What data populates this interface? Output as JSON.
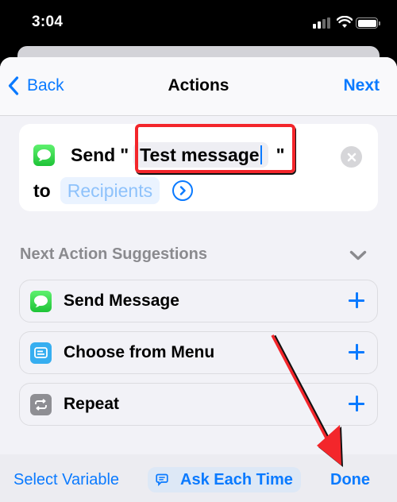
{
  "status_bar": {
    "time": "3:04",
    "icons": [
      "cellular-signal-icon",
      "wifi-icon",
      "battery-icon"
    ]
  },
  "navbar": {
    "back_label": "Back",
    "title": "Actions",
    "next_label": "Next"
  },
  "action": {
    "icon": "messages-icon",
    "verb": "Send",
    "open_quote": "\"",
    "message_text": "Test message",
    "close_quote": "\"",
    "to_label": "to",
    "recipients_placeholder": "Recipients"
  },
  "suggestions": {
    "header": "Next Action Suggestions",
    "items": [
      {
        "label": "Send Message",
        "icon": "messages-icon",
        "color": "#2fd44a"
      },
      {
        "label": "Choose from Menu",
        "icon": "menu-icon",
        "color": "#36aef0"
      },
      {
        "label": "Repeat",
        "icon": "repeat-icon",
        "color": "#8e8e93"
      }
    ]
  },
  "toolbar": {
    "select_variable": "Select Variable",
    "ask_each_time": "Ask Each Time",
    "done": "Done"
  },
  "colors": {
    "accent": "#0a7aff",
    "annotation": "#f3262b"
  }
}
